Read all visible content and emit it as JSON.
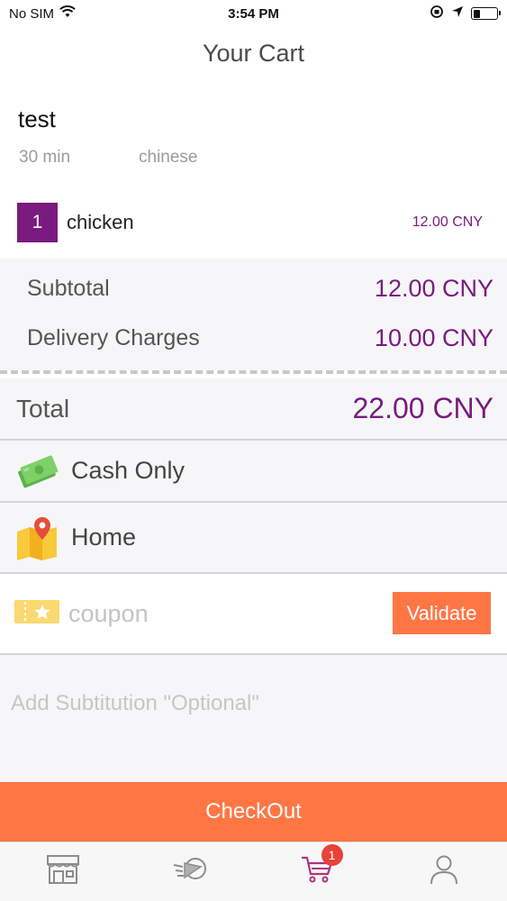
{
  "status_bar": {
    "carrier": "No SIM",
    "time": "3:54 PM"
  },
  "nav": {
    "title": "Your Cart"
  },
  "restaurant": {
    "name": "test",
    "delivery_time": "30 min",
    "cuisine": "chinese"
  },
  "items": [
    {
      "quantity": "1",
      "name": "chicken",
      "price": "12.00 CNY"
    }
  ],
  "summary": {
    "subtotal_label": "Subtotal",
    "subtotal_value": "12.00 CNY",
    "delivery_label": "Delivery Charges",
    "delivery_value": "10.00 CNY",
    "total_label": "Total",
    "total_value": "22.00 CNY"
  },
  "payment": {
    "label": "Cash Only",
    "icon": "cash-icon"
  },
  "address": {
    "label": "Home",
    "icon": "map-pin-icon"
  },
  "coupon": {
    "placeholder": "coupon",
    "value": "",
    "validate_label": "Validate",
    "icon": "coupon-ticket-icon"
  },
  "substitution": {
    "placeholder": "Add Subtitution \"Optional\"",
    "value": ""
  },
  "checkout": {
    "label": "CheckOut"
  },
  "tab_bar": {
    "tabs": [
      {
        "icon": "store-icon",
        "active": false
      },
      {
        "icon": "delivery-icon",
        "active": false
      },
      {
        "icon": "cart-icon",
        "active": true,
        "badge": "1"
      },
      {
        "icon": "profile-icon",
        "active": false
      }
    ]
  },
  "colors": {
    "accent_purple": "#7a1a7f",
    "accent_orange": "#ff7645",
    "badge_red": "#e8423a"
  }
}
